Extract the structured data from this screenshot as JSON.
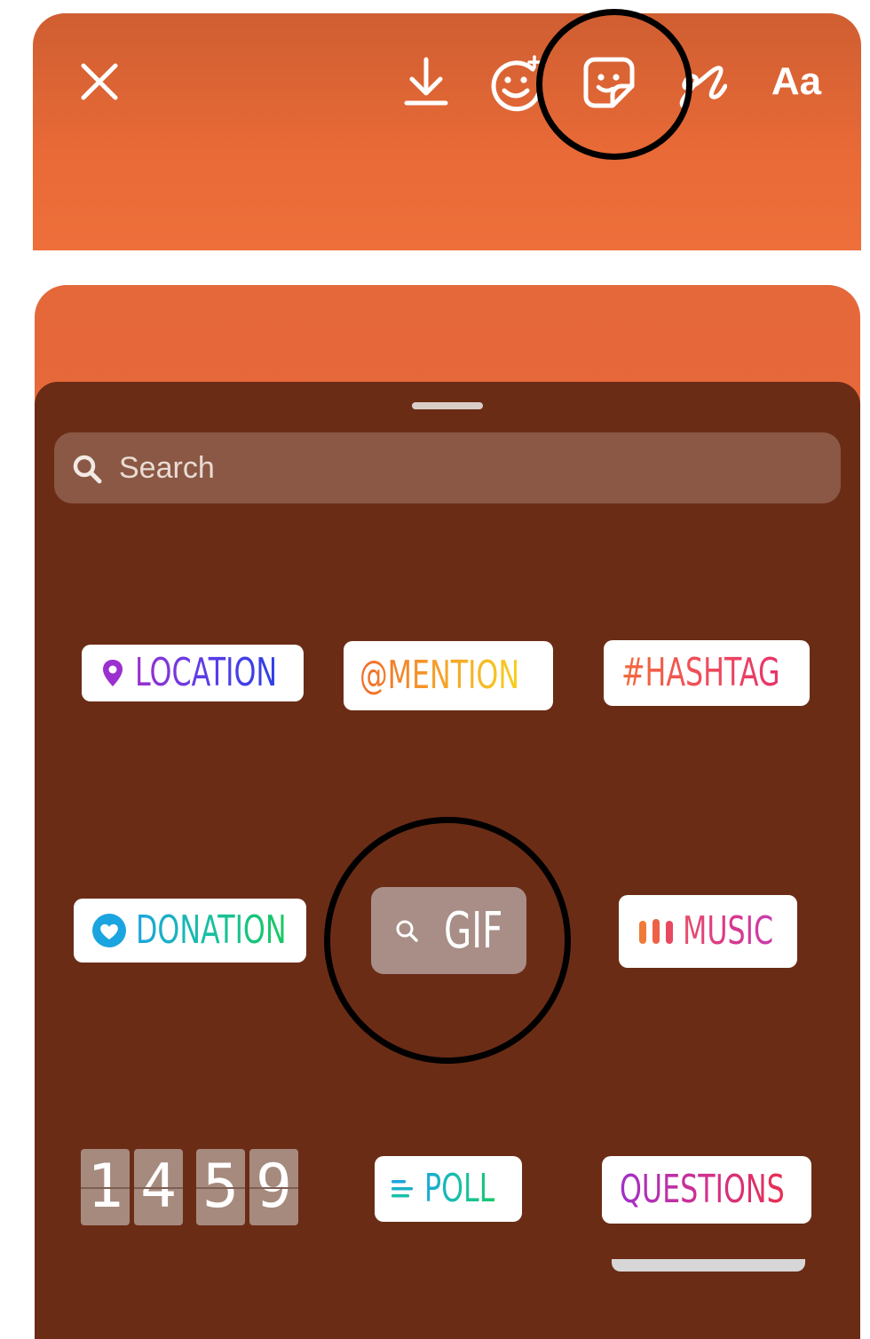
{
  "toolbar": {
    "close_icon": "close-icon",
    "download_icon": "download-icon",
    "effects_icon": "face-effects-icon",
    "sticker_icon": "sticker-icon",
    "draw_icon": "draw-icon",
    "text_label": "Aa"
  },
  "search": {
    "placeholder": "Search",
    "icon": "search-icon"
  },
  "stickers": {
    "location": "LOCATION",
    "mention": "@MENTION",
    "hashtag": "#HASHTAG",
    "donation": "DONATION",
    "gif": "GIF",
    "music": "MUSIC",
    "countdown_digits": [
      "1",
      "4",
      "5",
      "9"
    ],
    "poll": "POLL",
    "questions": "QUESTIONS"
  },
  "colors": {
    "accent_orange": "#e96a37",
    "sheet_brown": "#6b2c16",
    "location": "#8a2be2",
    "donation": "#18a8d8",
    "poll": "#18a8c8"
  }
}
